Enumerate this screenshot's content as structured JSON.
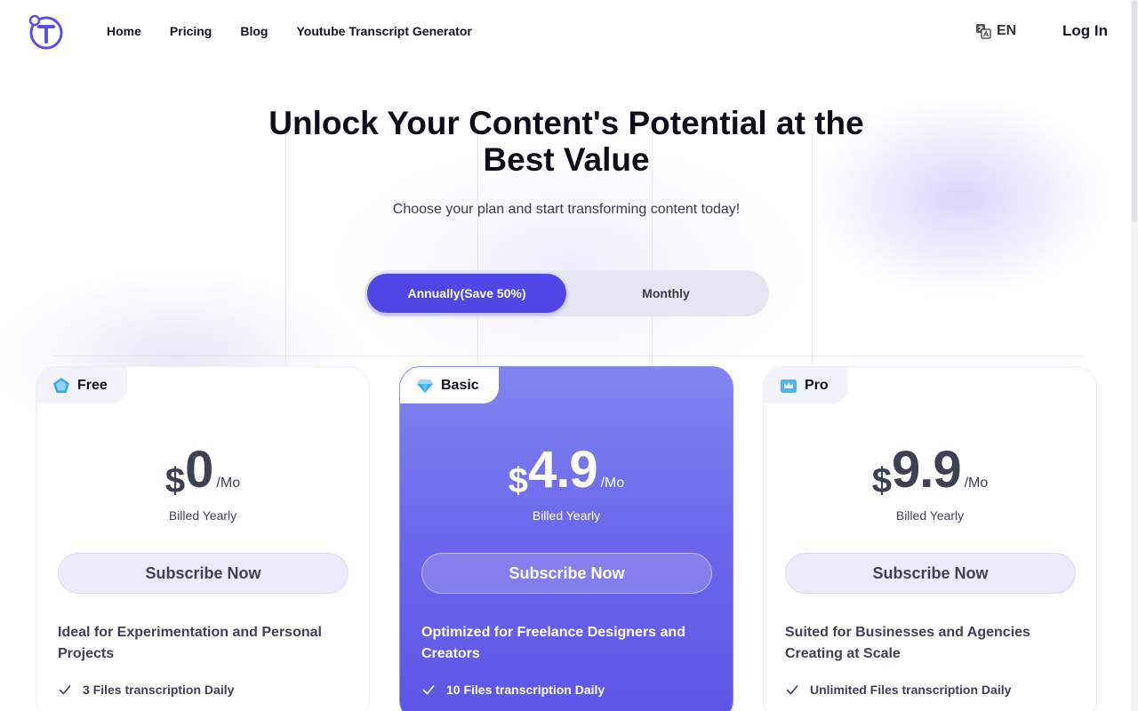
{
  "header": {
    "nav": [
      "Home",
      "Pricing",
      "Blog",
      "Youtube Transcript Generator"
    ],
    "language": "EN",
    "login": "Log In"
  },
  "hero": {
    "title_line1": "Unlock Your Content's Potential at the",
    "title_line2": "Best Value",
    "subtitle": "Choose your plan and start transforming content today!"
  },
  "billing_toggle": {
    "annual_label": "Annually(Save 50%)",
    "monthly_label": "Monthly",
    "selected": "annual"
  },
  "plans": [
    {
      "name": "Free",
      "currency": "$",
      "price": "0",
      "period": "/Mo",
      "billed": "Billed Yearly",
      "button": "Subscribe Now",
      "description": "Ideal for Experimentation and Personal Projects",
      "feature": "3 Files transcription Daily"
    },
    {
      "name": "Basic",
      "currency": "$",
      "price": "4.9",
      "period": "/Mo",
      "billed": "Billed Yearly",
      "button": "Subscribe Now",
      "description": "Optimized for Freelance Designers and Creators",
      "feature": "10 Files transcription Daily"
    },
    {
      "name": "Pro",
      "currency": "$",
      "price": "9.9",
      "period": "/Mo",
      "billed": "Billed Yearly",
      "button": "Subscribe Now",
      "description": "Suited for Businesses and Agencies Creating at Scale",
      "feature": "Unlimited Files transcription Daily"
    }
  ],
  "colors": {
    "accent": "#4f46e5",
    "basic_card_gradient_top": "#7f86f0",
    "basic_card_gradient_bottom": "#5d55e6",
    "button_light": "#ecebfb",
    "text_dark": "#0d0e1a"
  },
  "icons": {
    "logo": "t-logo-icon",
    "language": "translate-icon",
    "free_plan": "pentagon-gem-icon",
    "basic_plan": "diamond-icon",
    "pro_plan": "crown-box-icon",
    "feature": "check-icon"
  }
}
